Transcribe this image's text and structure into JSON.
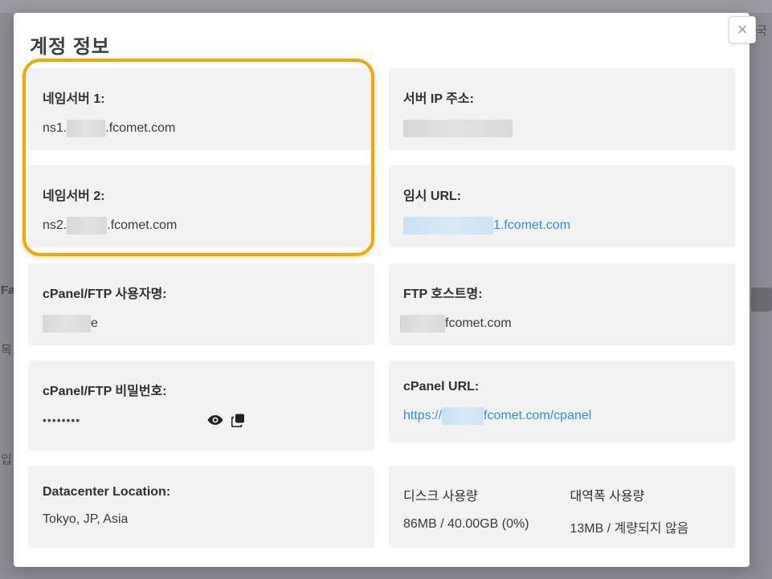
{
  "background": {
    "right_fragment_text": "국",
    "left_fragment_a": "Fa",
    "left_fragment_b": "목",
    "left_fragment_c": "입"
  },
  "modal": {
    "title": "계정 정보",
    "close_label": "×",
    "nameserver1": {
      "label": "네임서버 1:",
      "prefix": "ns1.",
      "suffix": ".fcomet.com"
    },
    "nameserver2": {
      "label": "네임서버 2:",
      "prefix": "ns2.",
      "suffix": ".fcomet.com"
    },
    "server_ip": {
      "label": "서버 IP 주소:"
    },
    "temp_url": {
      "label": "임시 URL:",
      "suffix": "1.fcomet.com"
    },
    "cpanel_user": {
      "label": "cPanel/FTP 사용자명:",
      "suffix": "e"
    },
    "ftp_host": {
      "label": "FTP 호스트명:",
      "suffix": "fcomet.com"
    },
    "cpanel_password": {
      "label": "cPanel/FTP 비밀번호:",
      "masked": "••••••••"
    },
    "cpanel_url": {
      "label": "cPanel URL:",
      "prefix": "https://",
      "suffix": "fcomet.com/cpanel"
    },
    "datacenter": {
      "label": "Datacenter Location:",
      "value": "Tokyo, JP, Asia"
    },
    "disk": {
      "label": "디스크 사용량",
      "value": "86MB / 40.00GB (0%)"
    },
    "bandwidth": {
      "label": "대역폭 사용량",
      "value": "13MB / 계량되지 않음"
    }
  },
  "colors": {
    "accent": "#f0a800",
    "link": "#2f8fd6",
    "card": "#f2f2f2"
  }
}
